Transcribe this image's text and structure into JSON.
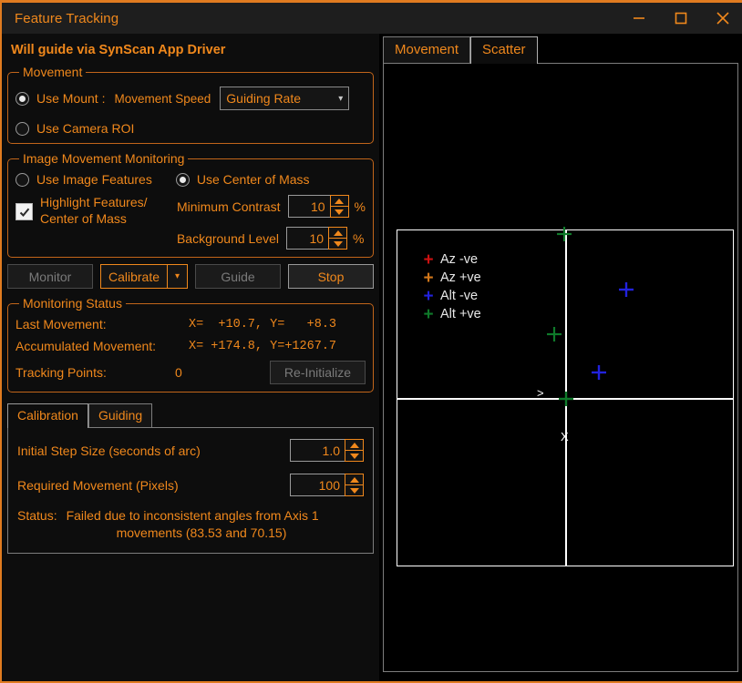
{
  "window": {
    "title": "Feature Tracking",
    "controls": [
      {
        "name": "minimize",
        "glyph": "minimize-icon"
      },
      {
        "name": "maximize",
        "glyph": "maximize-icon"
      },
      {
        "name": "close",
        "glyph": "close-icon"
      }
    ],
    "accent": "#f0881c",
    "border": "#e07b20"
  },
  "headline": "Will guide via SynScan App Driver",
  "movement_group": {
    "legend": "Movement",
    "use_mount_label": "Use Mount :",
    "use_mount_checked": true,
    "movement_speed_label": "Movement Speed",
    "speed_value": "Guiding Rate",
    "speed_options": [
      "Guiding Rate"
    ],
    "use_camera_roi_label": "Use Camera ROI",
    "use_camera_roi_checked": false
  },
  "monitoring_group": {
    "legend": "Image Movement Monitoring",
    "use_image_features_label": "Use Image Features",
    "use_image_features_checked": false,
    "use_center_of_mass_label": "Use Center of Mass",
    "use_center_of_mass_checked": true,
    "highlight_label_line1": "Highlight Features/",
    "highlight_label_line2": "Center of Mass",
    "highlight_checked": true,
    "min_contrast_label": "Minimum Contrast",
    "min_contrast_value": "10",
    "min_contrast_unit": "%",
    "background_level_label": "Background Level",
    "background_level_value": "10",
    "background_level_unit": "%"
  },
  "buttons": {
    "monitor": "Monitor",
    "monitor_enabled": false,
    "calibrate": "Calibrate",
    "calibrate_enabled": true,
    "guide": "Guide",
    "guide_enabled": false,
    "stop": "Stop",
    "stop_enabled": true
  },
  "status_group": {
    "legend": "Monitoring Status",
    "last_movement_label": "Last Movement:",
    "last_movement_value": "X=  +10.7, Y=   +8.3",
    "accumulated_label": "Accumulated Movement:",
    "accumulated_value": "X= +174.8, Y=+1267.7",
    "tracking_points_label": "Tracking Points:",
    "tracking_points_value": "0",
    "reinitialize_label": "Re-Initialize",
    "reinitialize_enabled": false
  },
  "bottom_tabs": {
    "tabs": [
      {
        "label": "Calibration",
        "active": true
      },
      {
        "label": "Guiding",
        "active": false
      }
    ],
    "calibration": {
      "initial_step_label": "Initial Step Size (seconds of arc)",
      "initial_step_value": "1.0",
      "required_movement_label": "Required Movement (Pixels)",
      "required_movement_value": "100",
      "status_label": "Status:",
      "status_line1": "Failed due to inconsistent angles from Axis 1",
      "status_line2": "movements (83.53 and 70.15)"
    }
  },
  "right_tabs": [
    {
      "label": "Movement",
      "active": false
    },
    {
      "label": "Scatter",
      "active": true
    }
  ],
  "chart_data": {
    "type": "scatter",
    "title": "Scatter",
    "xlabel": ">",
    "ylabel": "X",
    "grid": false,
    "legend_position": "upper-left-inside",
    "axis_origin_marker": "green-cross",
    "axis_labels": {
      "horizontal_arrow": ">",
      "vertical_marker": "X"
    },
    "xlim": [
      -100,
      100
    ],
    "ylim": [
      -100,
      100
    ],
    "series": [
      {
        "name": "Az -ve",
        "color": "#cc1111",
        "points": []
      },
      {
        "name": "Az +ve",
        "color": "#d2771a",
        "points": []
      },
      {
        "name": "Alt -ve",
        "color": "#2222dd",
        "points": [
          {
            "x": 28,
            "y": 42
          },
          {
            "x": 15,
            "y": 13
          }
        ]
      },
      {
        "name": "Alt +ve",
        "color": "#0f7a2a",
        "points": [
          {
            "x": -3,
            "y": 75
          },
          {
            "x": -9,
            "y": 28
          },
          {
            "x": 0,
            "y": 0
          }
        ]
      }
    ]
  }
}
